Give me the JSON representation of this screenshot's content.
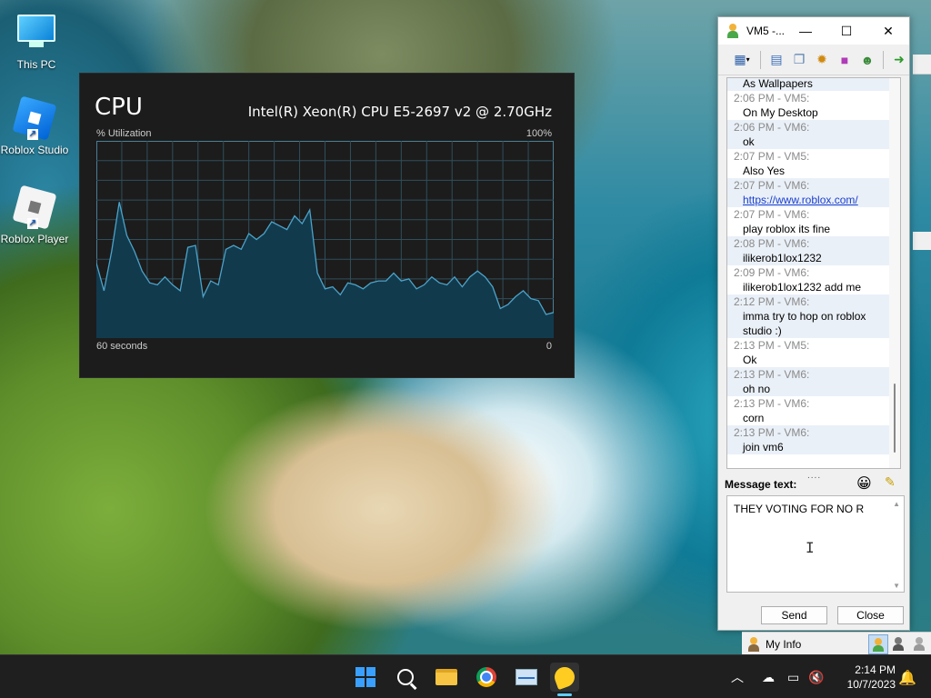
{
  "desktop": {
    "icons": [
      {
        "label": "This PC",
        "icon": "computer-icon"
      },
      {
        "label": "Roblox Studio",
        "icon": "roblox-studio-icon"
      },
      {
        "label": "Roblox Player",
        "icon": "roblox-player-icon"
      }
    ]
  },
  "cpu": {
    "title": "CPU",
    "model": "Intel(R) Xeon(R) CPU E5-2697 v2 @ 2.70GHz",
    "util_label": "% Utilization",
    "max_label": "100%",
    "time_label": "60 seconds",
    "min_label": "0",
    "line_color": "#4ba3c9",
    "fill_color": "#123a4d",
    "chart_data": {
      "type": "area",
      "xlabel": "60 seconds",
      "ylabel": "% Utilization",
      "ylim": [
        0,
        100
      ],
      "x": [
        60,
        59,
        58,
        57,
        56,
        55,
        54,
        53,
        52,
        51,
        50,
        49,
        48,
        47,
        46,
        45,
        44,
        43,
        42,
        41,
        40,
        39,
        38,
        37,
        36,
        35,
        34,
        33,
        32,
        31,
        30,
        29,
        28,
        27,
        26,
        25,
        24,
        23,
        22,
        21,
        20,
        19,
        18,
        17,
        16,
        15,
        14,
        13,
        12,
        11,
        10,
        9,
        8,
        7,
        6,
        5,
        4,
        3,
        2,
        1,
        0
      ],
      "values": [
        38,
        24,
        44,
        69,
        52,
        44,
        34,
        28,
        27,
        31,
        27,
        24,
        46,
        47,
        21,
        29,
        27,
        45,
        47,
        45,
        53,
        50,
        53,
        59,
        57,
        55,
        62,
        58,
        65,
        33,
        25,
        26,
        22,
        28,
        27,
        25,
        28,
        29,
        29,
        33,
        29,
        30,
        25,
        27,
        31,
        28,
        27,
        31,
        26,
        31,
        34,
        31,
        26,
        15,
        17,
        21,
        24,
        20,
        19,
        12,
        13
      ],
      "grid": true
    }
  },
  "chat": {
    "title": "VM5 -...",
    "toolbar_icons": [
      "security-dropdown-icon",
      "history-icon",
      "send-file-icon",
      "nudge-icon",
      "video-icon",
      "add-contact-icon",
      "exit-icon"
    ],
    "messages": [
      {
        "header": "",
        "body": "As Wallpapers"
      },
      {
        "header": "2:06 PM - VM5:",
        "body": "On My Desktop"
      },
      {
        "header": "2:06 PM - VM6:",
        "body": "ok"
      },
      {
        "header": "2:07 PM - VM5:",
        "body": "Also Yes"
      },
      {
        "header": "2:07 PM - VM6:",
        "body": "https://www.roblox.com/",
        "link": true
      },
      {
        "header": "2:07 PM - VM6:",
        "body": "play roblox its fine"
      },
      {
        "header": "2:08 PM - VM6:",
        "body": "ilikerob1lox1232"
      },
      {
        "header": "2:09 PM - VM6:",
        "body": "ilikerob1lox1232 add me"
      },
      {
        "header": "2:12 PM - VM6:",
        "body": "imma try to hop on roblox",
        "body2": "studio :)"
      },
      {
        "header": "2:13 PM - VM5:",
        "body": "Ok"
      },
      {
        "header": "2:13 PM - VM6:",
        "body": "oh no"
      },
      {
        "header": "2:13 PM - VM6:",
        "body": "corn"
      },
      {
        "header": "2:13 PM - VM6:",
        "body": "join vm6"
      }
    ],
    "grip": "....",
    "message_label": "Message text:",
    "draft": "THEY VOTING FOR NO R",
    "send_label": "Send",
    "close_label": "Close"
  },
  "buddy_bar": {
    "my_info": "My Info"
  },
  "taskbar": {
    "apps": [
      "start-icon",
      "search-icon",
      "file-explorer-icon",
      "chrome-icon",
      "photos-icon",
      "chat-app-icon"
    ],
    "time": "2:14 PM",
    "date": "10/7/2023"
  }
}
